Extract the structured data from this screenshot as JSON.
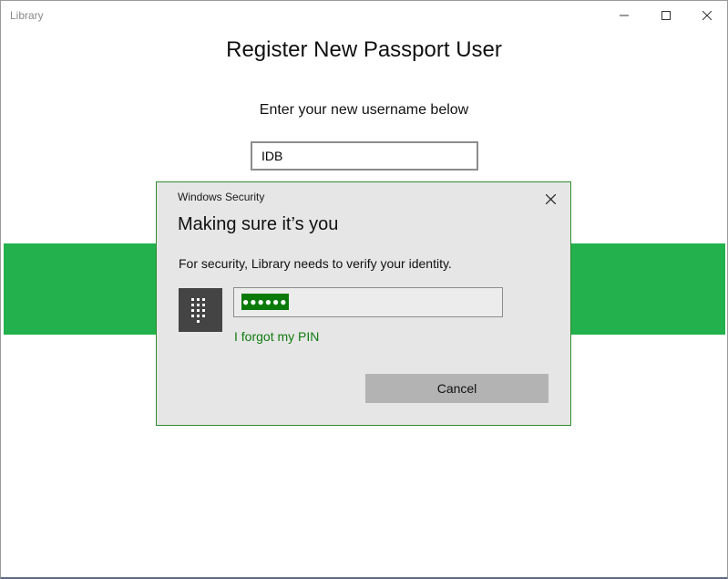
{
  "window": {
    "title": "Library",
    "controls": {
      "minimize": "minimize-icon",
      "maximize": "maximize-icon",
      "close": "close-icon"
    }
  },
  "page": {
    "heading": "Register New Passport User",
    "instruction": "Enter your new username below",
    "username_value": "IDB",
    "accent_color": "#22b14c"
  },
  "dialog": {
    "caption": "Windows Security",
    "heading": "Making sure it’s you",
    "message": "For security, Library needs to verify your identity.",
    "pin_icon": "keypad-icon",
    "pin_masked": "●●●●●●",
    "forgot_link": "I forgot my PIN",
    "cancel_label": "Cancel",
    "border_color": "#2e8b2e",
    "link_color": "#107c10"
  }
}
